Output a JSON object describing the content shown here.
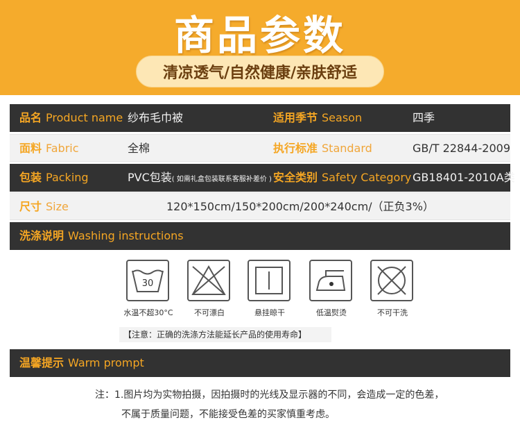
{
  "banner": {
    "title": "商品参数",
    "subtitle": "清凉透气/自然健康/亲肤舒适"
  },
  "params": {
    "product_name": {
      "label_cn": "品名",
      "label_en": "Product name",
      "value": "纱布毛巾被"
    },
    "season": {
      "label_cn": "适用季节",
      "label_en": "Season",
      "value": "四季"
    },
    "fabric": {
      "label_cn": "面料",
      "label_en": "Fabric",
      "value": "全棉"
    },
    "standard": {
      "label_cn": "执行标准",
      "label_en": "Standard",
      "value": "GB/T 22844-2009"
    },
    "packing": {
      "label_cn": "包装",
      "label_en": "Packing",
      "value": "PVC包装",
      "note": "( 如需礼盒包装联系客服补差价 )"
    },
    "safety": {
      "label_cn": "安全类别",
      "label_en": "Safety Category",
      "value": "GB18401-2010A类"
    },
    "size": {
      "label_cn": "尺寸",
      "label_en": "Size",
      "value": "120*150cm/150*200cm/200*240cm/（正负3%）"
    }
  },
  "washing": {
    "label_cn": "洗涤说明",
    "label_en": "Washing instructions",
    "items": [
      {
        "icon": "wash-30-icon",
        "number": "30",
        "label": "水温不超30°C"
      },
      {
        "icon": "no-bleach-icon",
        "label": "不可漂白"
      },
      {
        "icon": "hang-dry-icon",
        "label": "悬挂晾干"
      },
      {
        "icon": "low-iron-icon",
        "label": "低温熨烫"
      },
      {
        "icon": "no-dry-clean-icon",
        "label": "不可干洗"
      }
    ],
    "notice": "【注意：正确的洗涤方法能延长产品的使用寿命】"
  },
  "warm": {
    "label_cn": "温馨提示",
    "label_en": "Warm prompt",
    "line1": "注：1.图片均为实物拍摄，因拍摄时的光线及显示器的不同，会造成一定的色差，",
    "line2": "不属于质量问题，不能接受色差的买家慎重考虑。"
  },
  "colors": {
    "accent": "#f5ab2c",
    "dark_row": "#323232",
    "light_row": "#f2f2f2",
    "label_orange": "#f5a623"
  }
}
